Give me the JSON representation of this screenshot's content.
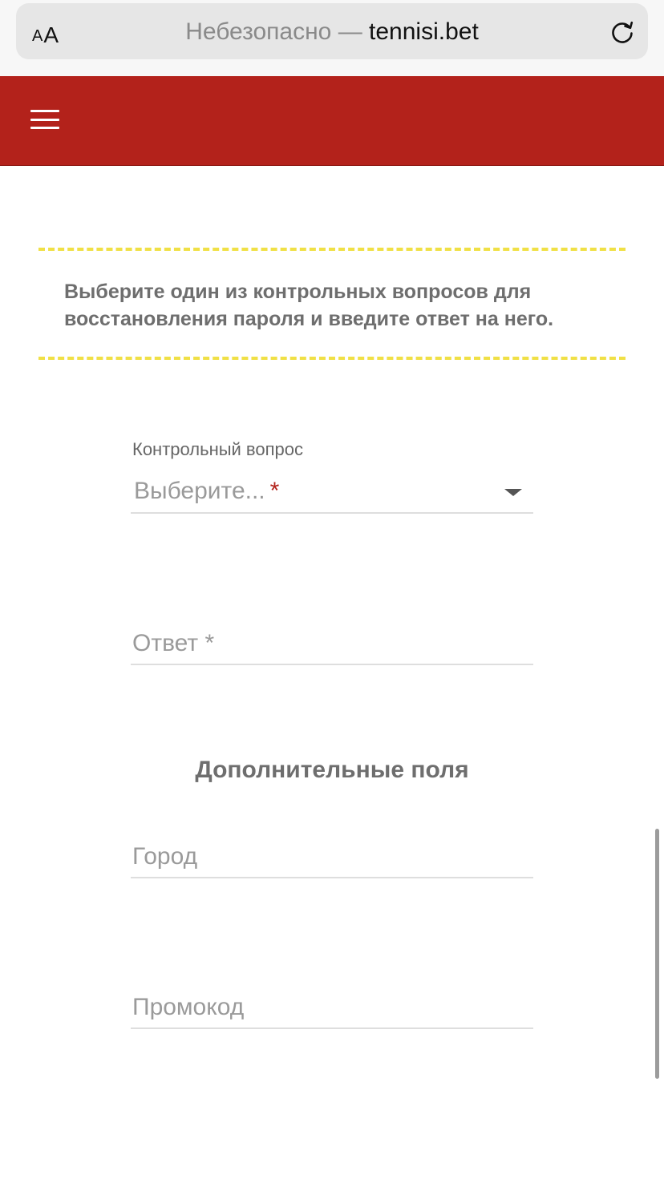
{
  "browser": {
    "text_size_small": "A",
    "text_size_large": "A",
    "security_label": "Небезопасно — ",
    "domain": "tennisi.bet"
  },
  "colors": {
    "header_bg": "#b3221b",
    "notice_border": "#f0e046",
    "required_mark": "#b3221b"
  },
  "notice": {
    "text": "Выберите один из контрольных вопросов для восстановления пароля и введите ответ на него."
  },
  "form": {
    "question_label": "Контрольный вопрос",
    "question_value": "Выберите...",
    "question_required": "*",
    "answer_placeholder": "Ответ *",
    "extra_title": "Дополнительные поля",
    "city_placeholder": "Город",
    "promo_placeholder": "Промокод"
  }
}
